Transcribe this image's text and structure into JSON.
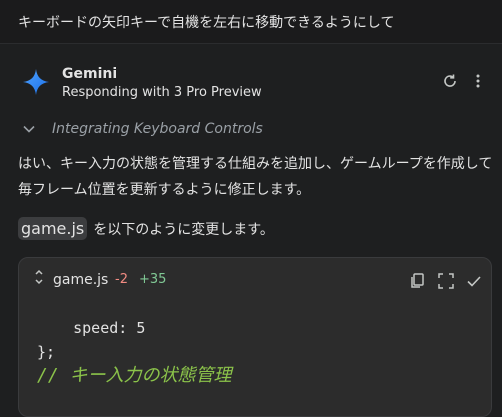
{
  "user_prompt": "キーボードの矢印キーで自機を左右に移動できるようにして",
  "header": {
    "model_name": "Gemini",
    "subtitle": "Responding with 3 Pro Preview"
  },
  "thinking": {
    "label": "Integrating Keyboard Controls"
  },
  "response": {
    "paragraph": "はい、キー入力の状態を管理する仕組みを追加し、ゲームループを作成して毎フレーム位置を更新するように修正します。",
    "file_chip": "game.js",
    "file_suffix": "を以下のように変更します。"
  },
  "code_block": {
    "filename": "game.js",
    "deletions": "-2",
    "additions": "+35",
    "lines": [
      "    speed: 5",
      "};",
      "",
      "// キー入力の状態管理"
    ]
  },
  "icons": {
    "model_logo": "gemini-sparkle-icon",
    "refresh": "refresh-icon",
    "more": "more-vert-icon",
    "expand": "chevron-down-icon",
    "code_expand": "unfold-icon",
    "copy": "copy-icon",
    "fullscreen": "fullscreen-icon",
    "accept": "check-icon"
  },
  "colors": {
    "background": "#1e1f20",
    "code_background": "#2c2c2c",
    "deletion": "#f28b82",
    "addition": "#81c995",
    "comment": "#8bc34a"
  }
}
